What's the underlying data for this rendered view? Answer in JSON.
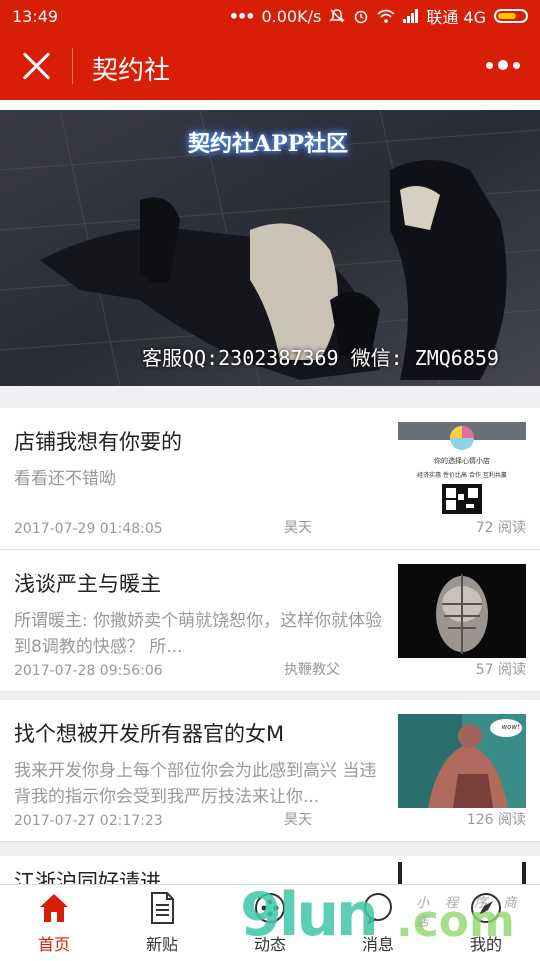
{
  "status_bar": {
    "time": "13:49",
    "network_speed": "0.00K/s",
    "carrier": "联通 4G",
    "icons": [
      "more-dots-icon",
      "mute-icon",
      "alarm-icon",
      "wifi-icon",
      "signal-icon",
      "battery-icon"
    ]
  },
  "title_bar": {
    "title": "契约社",
    "close_icon": "close-icon",
    "more_icon": "more-icon"
  },
  "banner": {
    "title": "契约社APP社区",
    "contact": "客服QQ:2302387369 微信: ZMQ6859"
  },
  "articles": [
    {
      "title": "店铺我想有你要的",
      "summary": "看看还不错呦",
      "date": "2017-07-29 01:48:05",
      "author": "昊天",
      "reads": "72 阅读",
      "thumb_text": [
        "你的选择心情小店",
        "经济实惠 性价比高 合作 互利共赢"
      ]
    },
    {
      "title": "浅谈严主与暖主",
      "summary": "所谓暖主: 你撒娇卖个萌就饶恕你，这样你就体验到8调教的快感？ 所...",
      "date": "2017-07-28 09:56:06",
      "author": "执鞭教父",
      "reads": "57 阅读"
    },
    {
      "title": "找个想被开发所有器官的女M",
      "summary": "我来开发你身上每个部位你会为此感到高兴 当违背我的指示你会受到我严厉技法来让你...",
      "date": "2017-07-27 02:17:23",
      "author": "昊天",
      "reads": "126 阅读",
      "thumb_text": [
        "wow!"
      ]
    },
    {
      "title": "江浙沪同好请进"
    }
  ],
  "tabs": [
    {
      "label": "首页",
      "icon": "home-icon",
      "active": true
    },
    {
      "label": "新贴",
      "icon": "document-icon",
      "active": false
    },
    {
      "label": "动态",
      "icon": "gamepad-icon",
      "active": false
    },
    {
      "label": "消息",
      "icon": "chat-icon",
      "active": false
    },
    {
      "label": "我的",
      "icon": "compass-icon",
      "active": false
    }
  ],
  "watermark": {
    "number": "9lun",
    "domain": ".com",
    "subtitle": "小 程 序 商 店"
  },
  "colors": {
    "brand_red": "#d81e06",
    "background": "#efeff4",
    "text_gray": "#999999",
    "battery_yellow": "#f7c400"
  }
}
